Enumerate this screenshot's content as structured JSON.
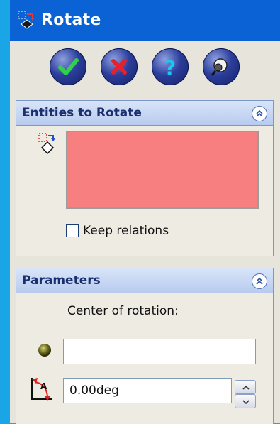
{
  "window": {
    "title": "Rotate"
  },
  "actions": {
    "ok": "ok-icon",
    "cancel": "cancel-icon",
    "help": "help-icon",
    "detail_preview": "detail-preview-icon"
  },
  "entities_section": {
    "title": "Entities to Rotate",
    "keep_relations_label": "Keep relations",
    "keep_relations_checked": false,
    "selection_color": "#f77f7f"
  },
  "parameters_section": {
    "title": "Parameters",
    "center_label": "Center of rotation:",
    "center_value": "",
    "angle_value": "0.00deg"
  },
  "colors": {
    "title_bar": "#0a62d4",
    "panel_bg": "#e7e4dc",
    "section_header_text": "#1a2f6e"
  }
}
